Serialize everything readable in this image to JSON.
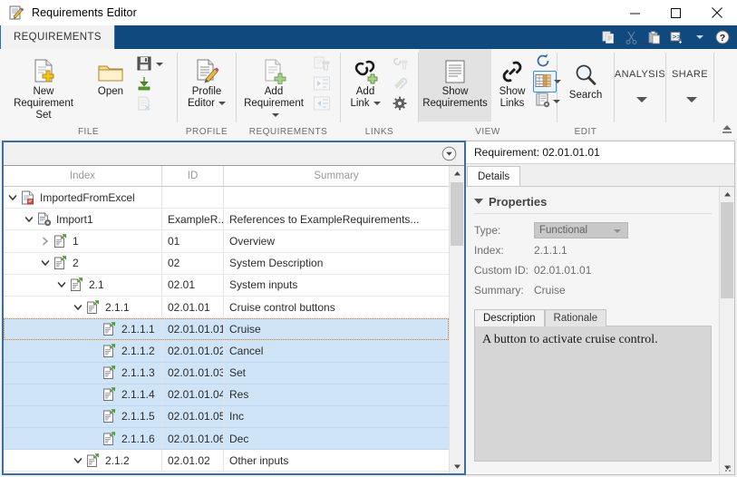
{
  "window": {
    "title": "Requirements Editor",
    "icon": "requirements-editor-icon",
    "minimize": "—",
    "maximize": "□",
    "close": "✕"
  },
  "quick_access": {
    "items": [
      {
        "name": "copy-icon",
        "label": "Copy",
        "enabled": true
      },
      {
        "name": "cut-icon",
        "label": "Cut",
        "enabled": false
      },
      {
        "name": "paste-icon",
        "label": "Paste",
        "enabled": true
      },
      {
        "name": "new-script-icon",
        "label": "New Script",
        "enabled": true
      },
      {
        "name": "quick-access-more-icon",
        "label": "More",
        "enabled": true
      },
      {
        "name": "help-icon",
        "label": "Help",
        "enabled": true
      }
    ]
  },
  "ribbon": {
    "tabs": [
      {
        "label": "REQUIREMENTS",
        "active": true
      }
    ],
    "groups": [
      {
        "label": "FILE",
        "buttons": [
          {
            "label_line1": "New",
            "label_line2": "Requirement Set",
            "icon": "new-requirement-set-icon"
          },
          {
            "label_line1": "Open",
            "label_line2": "",
            "icon": "open-folder-icon"
          }
        ],
        "small_buttons": [
          {
            "icon": "save-icon",
            "label": "Save",
            "has_caret": true
          },
          {
            "icon": "import-icon",
            "label": "Import",
            "has_caret": false
          },
          {
            "icon": "delete-file-icon",
            "label": "Close",
            "has_caret": false
          }
        ]
      },
      {
        "label": "PROFILE",
        "buttons": [
          {
            "label_line1": "Profile",
            "label_line2": "Editor",
            "icon": "profile-editor-icon",
            "has_caret": true
          }
        ],
        "small_buttons": []
      },
      {
        "label": "REQUIREMENTS",
        "buttons": [
          {
            "label_line1": "Add",
            "label_line2": "Requirement",
            "icon": "add-requirement-icon",
            "has_caret": true
          }
        ],
        "small_buttons": [
          {
            "icon": "delete-requirement-icon",
            "label": "Delete Requirement",
            "has_caret": false
          },
          {
            "icon": "promote-requirement-icon",
            "label": "Promote",
            "has_caret": false
          },
          {
            "icon": "demote-requirement-icon",
            "label": "Demote",
            "has_caret": false
          }
        ]
      },
      {
        "label": "LINKS",
        "buttons": [
          {
            "label_line1": "Add",
            "label_line2": "Link",
            "icon": "add-link-icon",
            "has_caret": true
          }
        ],
        "small_buttons": [
          {
            "icon": "delete-link-icon",
            "label": "Delete Link",
            "has_caret": false
          },
          {
            "icon": "link-attachment-icon",
            "label": "Link Attachment",
            "has_caret": false
          },
          {
            "icon": "link-settings-icon",
            "label": "Link Settings",
            "has_caret": false
          }
        ]
      },
      {
        "label": "VIEW",
        "buttons": [
          {
            "label_line1": "Show",
            "label_line2": "Requirements",
            "icon": "show-requirements-icon",
            "selected": true
          },
          {
            "label_line1": "Show",
            "label_line2": "Links",
            "icon": "show-links-icon"
          }
        ],
        "small_buttons": [
          {
            "icon": "refresh-icon",
            "label": "Refresh",
            "has_caret": false
          },
          {
            "icon": "columns-icon",
            "label": "Columns",
            "has_caret": true,
            "highlighted": true
          },
          {
            "icon": "report-icon",
            "label": "Report",
            "has_caret": true
          }
        ]
      },
      {
        "label": "EDIT",
        "buttons": [
          {
            "label_line1": "Search",
            "label_line2": "",
            "icon": "search-icon"
          }
        ],
        "small_buttons": []
      }
    ],
    "vertical_groups": [
      {
        "label": "ANALYSIS",
        "icon": "chevron-down-icon"
      },
      {
        "label": "SHARE",
        "icon": "chevron-down-icon"
      }
    ],
    "collapse_icon": "collapse-ribbon-icon"
  },
  "tree_panel": {
    "dropdown_icon": "panel-options-icon",
    "columns": [
      "Index",
      "ID",
      "Summary"
    ],
    "rows": [
      {
        "depth": 0,
        "twisty": "expanded",
        "icon": "requirement-set-icon",
        "index": "ImportedFromExcel",
        "id": "",
        "summary": "",
        "selected": false,
        "focused": false
      },
      {
        "depth": 1,
        "twisty": "expanded",
        "icon": "import-node-icon",
        "index": "Import1",
        "id": "ExampleR...",
        "summary": "References to ExampleRequirements...",
        "selected": false,
        "focused": false
      },
      {
        "depth": 2,
        "twisty": "collapsed",
        "icon": "requirement-icon",
        "index": "1",
        "id": "01",
        "summary": "Overview",
        "selected": false,
        "focused": false
      },
      {
        "depth": 2,
        "twisty": "expanded",
        "icon": "requirement-icon",
        "index": "2",
        "id": "02",
        "summary": "System Description",
        "selected": false,
        "focused": false
      },
      {
        "depth": 3,
        "twisty": "expanded",
        "icon": "requirement-icon",
        "index": "2.1",
        "id": "02.01",
        "summary": "System inputs",
        "selected": false,
        "focused": false
      },
      {
        "depth": 4,
        "twisty": "expanded",
        "icon": "requirement-icon",
        "index": "2.1.1",
        "id": "02.01.01",
        "summary": "Cruise control buttons",
        "selected": false,
        "focused": false
      },
      {
        "depth": 5,
        "twisty": "none",
        "icon": "requirement-icon",
        "index": "2.1.1.1",
        "id": "02.01.01.01",
        "summary": "Cruise",
        "selected": true,
        "focused": true
      },
      {
        "depth": 5,
        "twisty": "none",
        "icon": "requirement-icon",
        "index": "2.1.1.2",
        "id": "02.01.01.02",
        "summary": "Cancel",
        "selected": true,
        "focused": false
      },
      {
        "depth": 5,
        "twisty": "none",
        "icon": "requirement-icon",
        "index": "2.1.1.3",
        "id": "02.01.01.03",
        "summary": "Set",
        "selected": true,
        "focused": false
      },
      {
        "depth": 5,
        "twisty": "none",
        "icon": "requirement-icon",
        "index": "2.1.1.4",
        "id": "02.01.01.04",
        "summary": "Res",
        "selected": true,
        "focused": false
      },
      {
        "depth": 5,
        "twisty": "none",
        "icon": "requirement-icon",
        "index": "2.1.1.5",
        "id": "02.01.01.05",
        "summary": "Inc",
        "selected": true,
        "focused": false
      },
      {
        "depth": 5,
        "twisty": "none",
        "icon": "requirement-icon",
        "index": "2.1.1.6",
        "id": "02.01.01.06",
        "summary": "Dec",
        "selected": true,
        "focused": false
      },
      {
        "depth": 4,
        "twisty": "expanded",
        "icon": "requirement-icon",
        "index": "2.1.2",
        "id": "02.01.02",
        "summary": "Other inputs",
        "selected": false,
        "focused": false
      }
    ]
  },
  "details_panel": {
    "title": "Requirement: 02.01.01.01",
    "tabs": [
      {
        "label": "Details",
        "active": true
      }
    ],
    "properties": {
      "section_label": "Properties",
      "type_label": "Type:",
      "type_value": "Functional",
      "index_label": "Index:",
      "index_value": "2.1.1.1",
      "custom_id_label": "Custom ID:",
      "custom_id_value": "02.01.01.01",
      "summary_label": "Summary:",
      "summary_value": "Cruise"
    },
    "description_tabs": [
      {
        "label": "Description",
        "active": true
      },
      {
        "label": "Rationale",
        "active": false
      }
    ],
    "description_text": "A button to activate cruise control."
  },
  "colors": {
    "ribbon_accent": "#10497e",
    "panel_border": "#3a6ea5",
    "selection": "#cfe4f7",
    "focus_outline": "#e07b1a"
  }
}
